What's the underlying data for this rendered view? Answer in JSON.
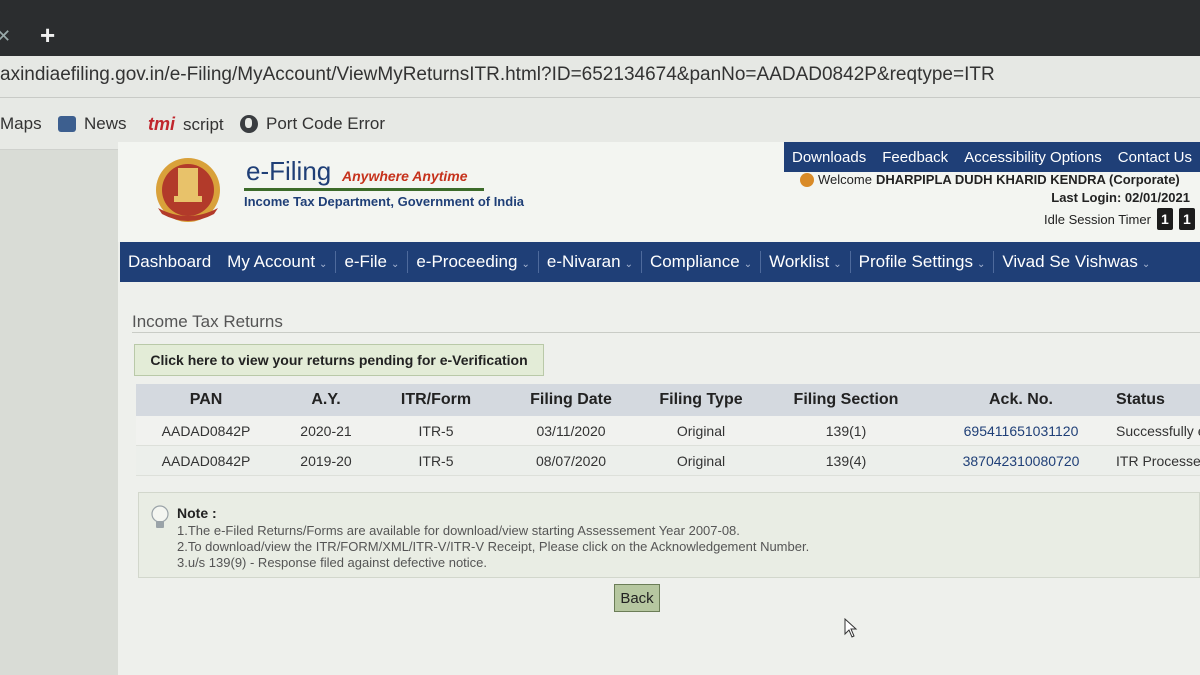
{
  "browser": {
    "url": "axindiaefiling.gov.in/e-Filing/MyAccount/ViewMyReturnsITR.html?ID=652134674&panNo=AADAD0842P&reqtype=ITR",
    "new_tab": "+",
    "bookmarks": [
      "Maps",
      "News",
      "script",
      "Port Code Error"
    ],
    "tmi_label": "tmi"
  },
  "header": {
    "brand_title": "e-Filing",
    "brand_tagline": "Anywhere Anytime",
    "brand_subtitle": "Income Tax Department, Government of India",
    "top_links": [
      "Downloads",
      "Feedback",
      "Accessibility Options",
      "Contact Us"
    ],
    "welcome_prefix": "Welcome",
    "user_name": "DHARPIPLA DUDH KHARID KENDRA (Corporate)",
    "last_login": "Last Login: 02/01/2021",
    "idle_label": "Idle Session Timer",
    "idle_digits": [
      "1",
      "1"
    ]
  },
  "nav": {
    "items": [
      "Dashboard",
      "My Account",
      "e-File",
      "e-Proceeding",
      "e-Nivaran",
      "Compliance",
      "Worklist",
      "Profile Settings",
      "Vivad Se Vishwas"
    ],
    "caret": "⌄"
  },
  "main": {
    "section_title": "Income Tax Returns",
    "pending_button": "Click here to view your returns pending for e-Verification",
    "table": {
      "headers": [
        "PAN",
        "A.Y.",
        "ITR/Form",
        "Filing Date",
        "Filing Type",
        "Filing Section",
        "Ack. No.",
        "Status"
      ],
      "rows": [
        [
          "AADAD0842P",
          "2020-21",
          "ITR-5",
          "03/11/2020",
          "Original",
          "139(1)",
          "695411651031120",
          "Successfully e-Verified"
        ],
        [
          "AADAD0842P",
          "2019-20",
          "ITR-5",
          "08/07/2020",
          "Original",
          "139(4)",
          "387042310080720",
          "ITR Processed"
        ]
      ]
    },
    "note_title": "Note :",
    "notes": [
      "1.The e-Filed Returns/Forms are available for download/view starting Assessement Year 2007-08.",
      "2.To download/view the ITR/FORM/XML/ITR-V/ITR-V Receipt, Please click on the Acknowledgement Number.",
      "3.u/s 139(9) - Response filed against defective notice."
    ],
    "back_button": "Back"
  },
  "colors": {
    "nav_blue": "#1f3f77",
    "tagline_red": "#c6321c",
    "accent_green": "#3c6b2a"
  }
}
